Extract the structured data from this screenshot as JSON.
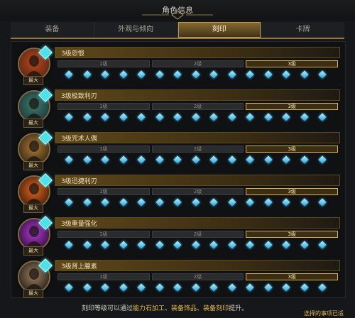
{
  "window": {
    "title": "角色信息"
  },
  "tabs": [
    {
      "label": "装备",
      "active": false
    },
    {
      "label": "外观与倾向",
      "active": false
    },
    {
      "label": "刻印",
      "active": true
    },
    {
      "label": "卡牌",
      "active": false
    }
  ],
  "level_labels": [
    "1级",
    "2级",
    "3级"
  ],
  "engravings": [
    {
      "name": "3级怨恨",
      "badge": "最大",
      "active_level": 3
    },
    {
      "name": "3级极致利刃",
      "badge": "最大",
      "active_level": 3
    },
    {
      "name": "3级咒术人偶",
      "badge": "最大",
      "active_level": 3
    },
    {
      "name": "3级迅捷利刃",
      "badge": "最大",
      "active_level": 3
    },
    {
      "name": "3级重量强化",
      "badge": "最大",
      "active_level": 3
    },
    {
      "name": "3级肾上腺素",
      "badge": "最大",
      "active_level": 3
    }
  ],
  "footer": {
    "prefix": "刻印等级可以通过",
    "highlight1": "能力石加工",
    "sep1": "、",
    "highlight2": "装备饰品",
    "sep2": "、",
    "highlight3": "装备刻印",
    "suffix": "提升。",
    "corner_hint": "选择的事项已适"
  },
  "colors": {
    "accent_gold": "#c09a4b",
    "highlight_text": "#e7b94a",
    "gem_cyan": "#4fe0ea",
    "diamond_blue": "#2a9fd8"
  }
}
